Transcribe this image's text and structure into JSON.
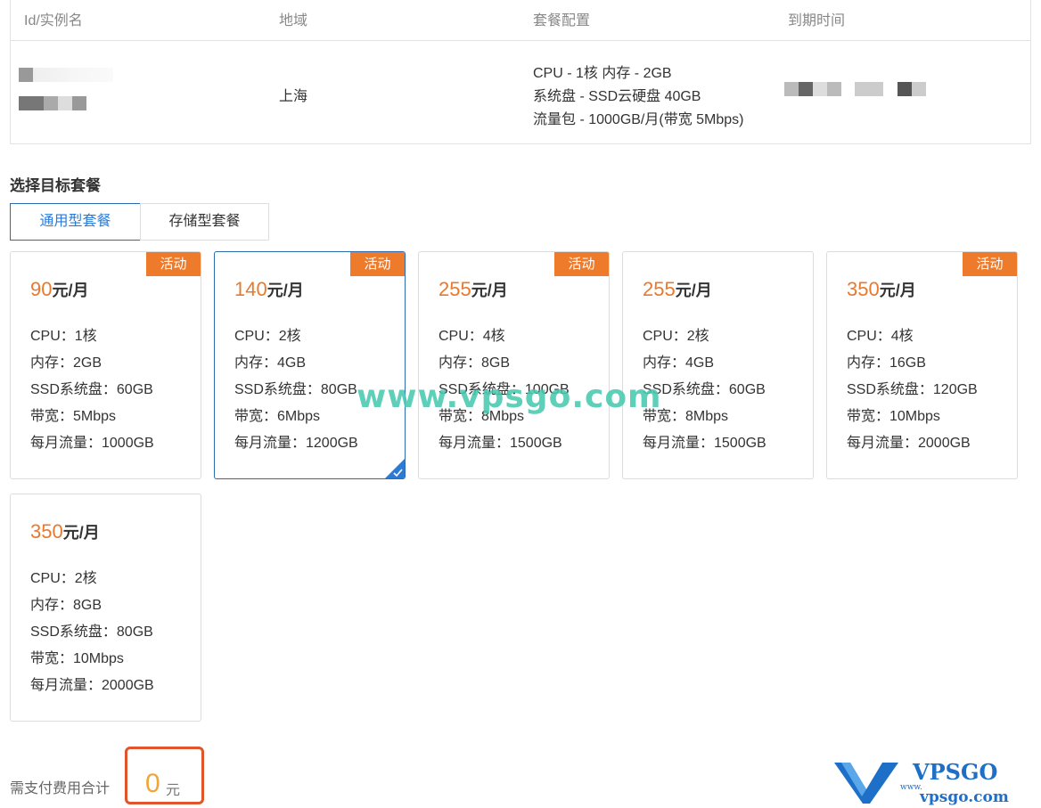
{
  "table": {
    "headers": {
      "instance": "Id/实例名",
      "region": "地域",
      "config": "套餐配置",
      "expire": "到期时间"
    },
    "row": {
      "region": "上海",
      "config_lines": [
        "CPU - 1核 内存 - 2GB",
        "系统盘 - SSD云硬盘 40GB",
        "流量包 - 1000GB/月(带宽 5Mbps)"
      ]
    }
  },
  "section_title": "选择目标套餐",
  "tabs": [
    {
      "label": "通用型套餐",
      "active": true
    },
    {
      "label": "存储型套餐",
      "active": false
    }
  ],
  "plans": [
    {
      "price": "90",
      "unit": "元/月",
      "badge": "活动",
      "selected": false,
      "specs": [
        "CPU：1核",
        "内存：2GB",
        "SSD系统盘：60GB",
        "带宽：5Mbps",
        "每月流量：1000GB"
      ]
    },
    {
      "price": "140",
      "unit": "元/月",
      "badge": "活动",
      "selected": true,
      "specs": [
        "CPU：2核",
        "内存：4GB",
        "SSD系统盘：80GB",
        "带宽：6Mbps",
        "每月流量：1200GB"
      ]
    },
    {
      "price": "255",
      "unit": "元/月",
      "badge": "活动",
      "selected": false,
      "specs": [
        "CPU：4核",
        "内存：8GB",
        "SSD系统盘：100GB",
        "带宽：8Mbps",
        "每月流量：1500GB"
      ]
    },
    {
      "price": "255",
      "unit": "元/月",
      "badge": "",
      "selected": false,
      "specs": [
        "CPU：2核",
        "内存：4GB",
        "SSD系统盘：60GB",
        "带宽：8Mbps",
        "每月流量：1500GB"
      ]
    },
    {
      "price": "350",
      "unit": "元/月",
      "badge": "活动",
      "selected": false,
      "specs": [
        "CPU：4核",
        "内存：16GB",
        "SSD系统盘：120GB",
        "带宽：10Mbps",
        "每月流量：2000GB"
      ]
    },
    {
      "price": "350",
      "unit": "元/月",
      "badge": "",
      "selected": false,
      "specs": [
        "CPU：2核",
        "内存：8GB",
        "SSD系统盘：80GB",
        "带宽：10Mbps",
        "每月流量：2000GB"
      ]
    }
  ],
  "watermark": "www.vpsgo.com",
  "total": {
    "label": "需支付费用合计",
    "amount": "0",
    "unit": "元"
  },
  "logo": {
    "brand": "VPSGO",
    "domain": "vpsgo.com",
    "prefix": "www."
  },
  "colors": {
    "accent_blue": "#2b7ad6",
    "price_orange": "#e8792d",
    "badge_orange": "#ee7b2c",
    "total_border": "#e0552c",
    "watermark": "#48c9b0",
    "logo_blue": "#1e6fc8"
  }
}
